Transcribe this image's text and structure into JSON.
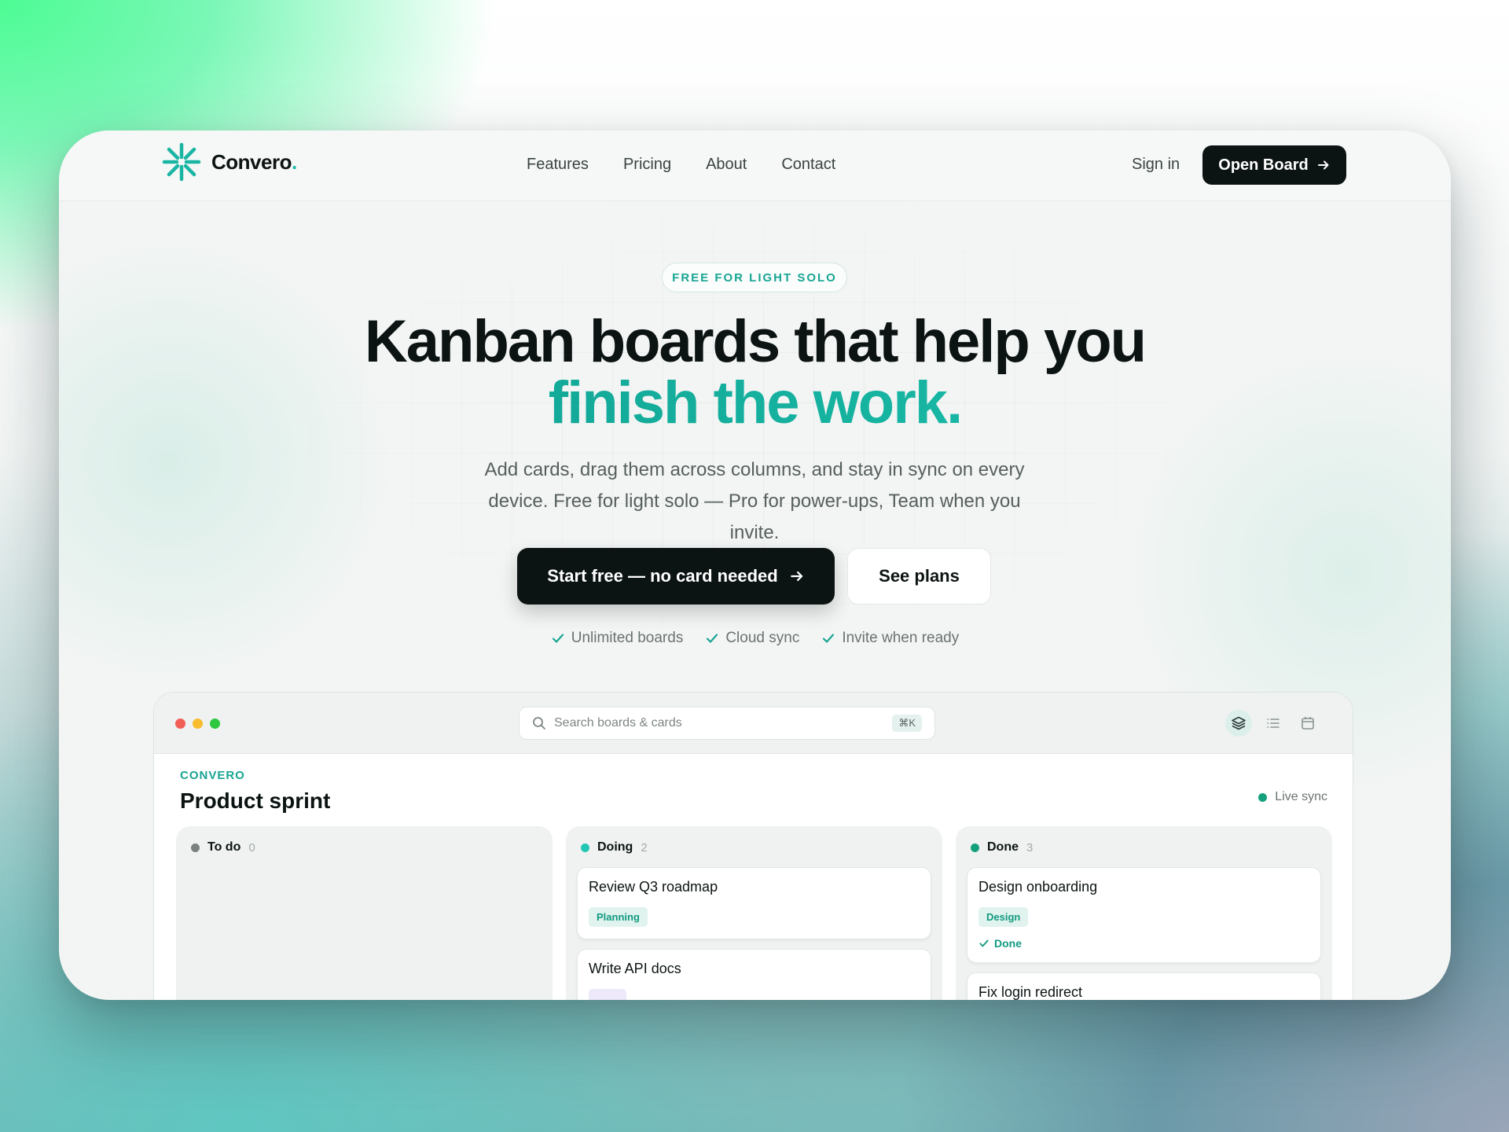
{
  "brand": {
    "name": "Convero",
    "dot": "."
  },
  "nav": {
    "links": [
      "Features",
      "Pricing",
      "About",
      "Contact"
    ],
    "signin": "Sign in",
    "open_board": "Open Board"
  },
  "hero": {
    "pill": "FREE FOR LIGHT SOLO",
    "title_line1": "Kanban boards that help you",
    "title_line2": "finish the work.",
    "subtitle": "Add cards, drag them across columns, and stay in sync on every device. Free for light solo — Pro for power-ups, Team when you invite.",
    "cta_primary": "Start free — no card needed",
    "cta_secondary": "See plans",
    "checks": [
      "Unlimited boards",
      "Cloud sync",
      "Invite when ready"
    ]
  },
  "app": {
    "search_placeholder": "Search boards & cards",
    "search_shortcut": "⌘K",
    "view_icons": [
      "layers-icon",
      "list-icon",
      "calendar-icon"
    ],
    "board_brand": "CONVERO",
    "board_title": "Product sprint",
    "live_status": "Live sync",
    "columns": [
      {
        "name": "To do",
        "count": "0",
        "color": "#7a8280",
        "cards": []
      },
      {
        "name": "Doing",
        "count": "2",
        "color": "#22c7b3",
        "cards": [
          {
            "title": "Review Q3 roadmap",
            "tag": "Planning",
            "tag_color": "green"
          },
          {
            "title": "Write API docs",
            "tag": "",
            "tag_color": "purple"
          }
        ]
      },
      {
        "name": "Done",
        "count": "3",
        "color": "#13a07b",
        "cards": [
          {
            "title": "Design onboarding",
            "tag": "Design",
            "tag_color": "green",
            "status": "Done"
          },
          {
            "title": "Fix login redirect",
            "tag": "",
            "tag_color": "green"
          }
        ]
      }
    ]
  },
  "colors": {
    "accent": "#17a593",
    "dark": "#0c1413",
    "traffic": [
      "#f25f57",
      "#f8bc2e",
      "#2dc840"
    ]
  }
}
